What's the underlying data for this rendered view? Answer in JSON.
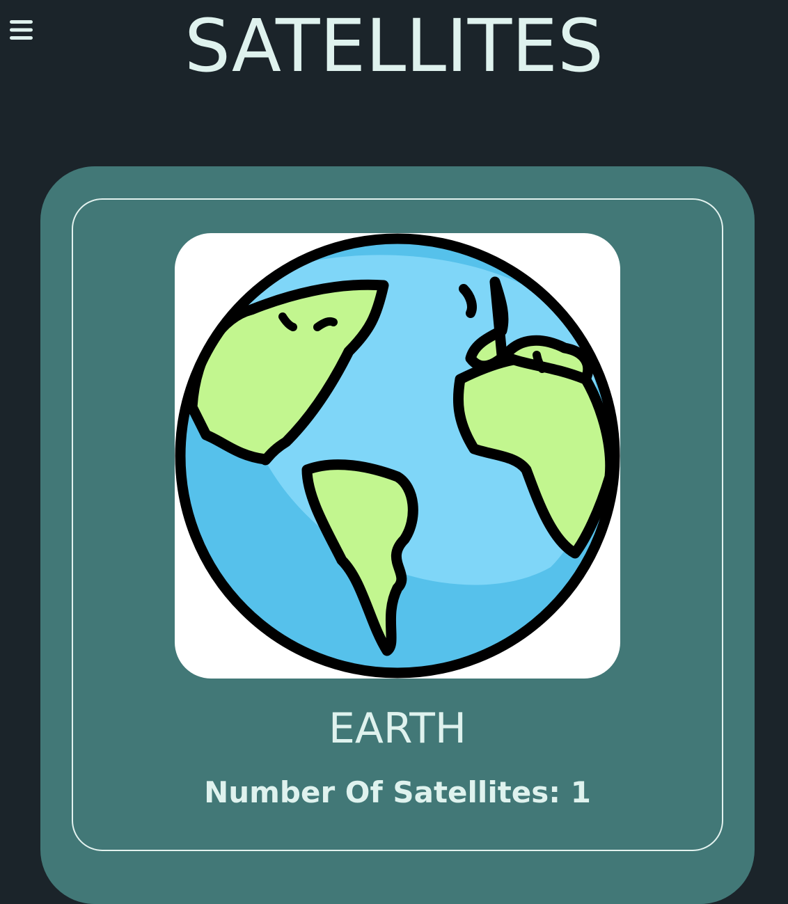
{
  "header": {
    "menu_icon": "hamburger-menu-icon",
    "title": "SATELLITES"
  },
  "planet": {
    "name": "EARTH",
    "satellites_text": "Number Of Satellites: 1",
    "image_icon": "earth-globe-icon"
  },
  "colors": {
    "background": "#1b242a",
    "card": "#427877",
    "card_border": "#e3f2ef",
    "text": "#dff2ee",
    "ocean": "#56c1eb",
    "ocean_light": "#7fd6f8",
    "land": "#c2f68f"
  }
}
